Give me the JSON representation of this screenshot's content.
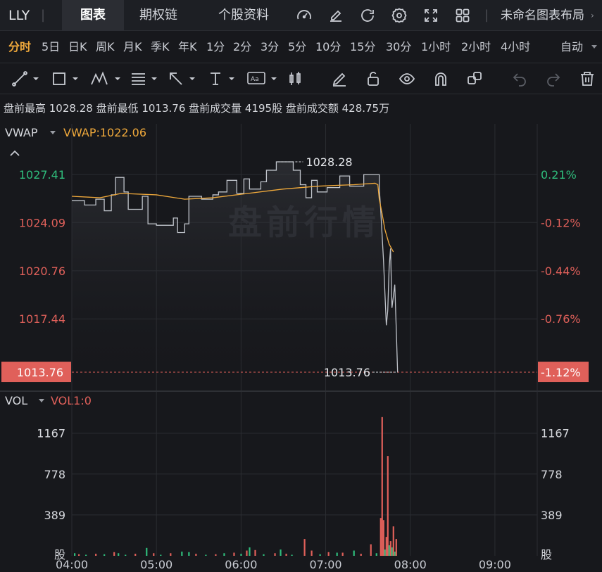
{
  "topbar": {
    "ticker": "LLY",
    "separator": "|",
    "tabs": [
      {
        "label": "图表",
        "active": true
      },
      {
        "label": "期权链",
        "active": false
      },
      {
        "label": "个股资料",
        "active": false
      }
    ],
    "icons": [
      "gauge-icon",
      "edit-icon",
      "refresh-icon",
      "settings-icon",
      "fullscreen-icon",
      "grid-layout-icon"
    ],
    "layout_name": "未命名图表布局",
    "layout_chevron": "›"
  },
  "periods": {
    "items": [
      "分时",
      "5日",
      "日K",
      "周K",
      "月K",
      "季K",
      "年K",
      "1分",
      "2分",
      "3分",
      "5分",
      "10分",
      "15分",
      "30分",
      "1小时",
      "2小时",
      "4小时"
    ],
    "active": "分时",
    "mode": "自动"
  },
  "toolbar": {
    "tools": [
      "line-tool-icon",
      "rectangle-tool-icon",
      "pattern-tool-icon",
      "fibonacci-tool-icon",
      "arrow-tool-icon",
      "text-tool-icon",
      "annotation-tool-icon",
      "candle-tool-icon",
      "pencil-icon",
      "unlock-icon",
      "eye-icon",
      "magnet-icon",
      "copy-icon",
      "undo-icon",
      "redo-icon",
      "trash-icon"
    ]
  },
  "info": {
    "text": "盘前最高 1028.28 盘前最低 1013.76 盘前成交量 4195股 盘前成交额 428.75万"
  },
  "chart_data": {
    "type": "line",
    "watermark": "盘前行情",
    "indicator": {
      "name": "VWAP",
      "label": "VWAP:1022.06"
    },
    "price_axis": {
      "ticks": [
        "1027.41",
        "1024.09",
        "1020.76",
        "1017.44"
      ],
      "current": "1013.76",
      "ylim": [
        1012.5,
        1030.9
      ]
    },
    "percent_axis": {
      "ticks": [
        "0.21%",
        "-0.12%",
        "-0.44%",
        "-0.76%"
      ],
      "current": "-1.12%"
    },
    "high_label": "1028.28",
    "low_label": "1013.76",
    "time_axis": {
      "labels": [
        "04:00",
        "05:00",
        "06:00",
        "07:00",
        "08:00",
        "09:00"
      ],
      "xlim_minutes": [
        0,
        330
      ]
    },
    "series": [
      {
        "name": "price",
        "color": "#bfc3ca",
        "points": [
          [
            0,
            1025.6
          ],
          [
            9,
            1025.6
          ],
          [
            9,
            1025.3
          ],
          [
            17,
            1025.3
          ],
          [
            17,
            1025.7
          ],
          [
            23,
            1025.7
          ],
          [
            23,
            1024.9
          ],
          [
            28,
            1024.9
          ],
          [
            28,
            1026.0
          ],
          [
            31,
            1026.0
          ],
          [
            31,
            1027.2
          ],
          [
            37,
            1027.2
          ],
          [
            37,
            1026.2
          ],
          [
            40,
            1026.2
          ],
          [
            40,
            1025.0
          ],
          [
            50,
            1025.0
          ],
          [
            50,
            1025.9
          ],
          [
            54,
            1025.9
          ],
          [
            54,
            1024.0
          ],
          [
            60,
            1024.0
          ],
          [
            60,
            1023.9
          ],
          [
            72,
            1023.9
          ],
          [
            72,
            1024.4
          ],
          [
            75,
            1024.4
          ],
          [
            75,
            1023.4
          ],
          [
            80,
            1023.4
          ],
          [
            80,
            1024.0
          ],
          [
            83,
            1024.0
          ],
          [
            83,
            1025.9
          ],
          [
            92,
            1025.9
          ],
          [
            92,
            1025.7
          ],
          [
            100,
            1025.7
          ],
          [
            100,
            1026.0
          ],
          [
            104,
            1026.0
          ],
          [
            104,
            1026.2
          ],
          [
            110,
            1026.2
          ],
          [
            110,
            1027.0
          ],
          [
            117,
            1027.0
          ],
          [
            117,
            1026.1
          ],
          [
            122,
            1026.1
          ],
          [
            122,
            1027.1
          ],
          [
            126,
            1027.1
          ],
          [
            126,
            1026.4
          ],
          [
            134,
            1026.4
          ],
          [
            134,
            1026.9
          ],
          [
            138,
            1026.9
          ],
          [
            138,
            1027.7
          ],
          [
            145,
            1027.7
          ],
          [
            145,
            1028.28
          ],
          [
            157,
            1028.28
          ],
          [
            157,
            1027.7
          ],
          [
            162,
            1027.7
          ],
          [
            162,
            1026.7
          ],
          [
            166,
            1026.7
          ],
          [
            166,
            1025.8
          ],
          [
            170,
            1025.8
          ],
          [
            170,
            1027.0
          ],
          [
            174,
            1027.0
          ],
          [
            174,
            1026.2
          ],
          [
            181,
            1026.2
          ],
          [
            181,
            1026.5
          ],
          [
            190,
            1026.5
          ],
          [
            190,
            1027.3
          ],
          [
            197,
            1027.3
          ],
          [
            197,
            1026.6
          ],
          [
            207,
            1026.6
          ],
          [
            207,
            1027.4
          ],
          [
            218,
            1027.4
          ],
          [
            218,
            1026.5
          ],
          [
            219,
            1025.0
          ],
          [
            221,
            1021.5
          ],
          [
            223,
            1017.0
          ],
          [
            224,
            1018.0
          ],
          [
            225,
            1021.0
          ],
          [
            226,
            1022.3
          ],
          [
            227,
            1018.2
          ],
          [
            228,
            1019.0
          ],
          [
            229,
            1019.8
          ],
          [
            230,
            1016.9
          ],
          [
            231,
            1013.76
          ]
        ]
      },
      {
        "name": "VWAP",
        "color": "#f0a93b",
        "points": [
          [
            0,
            1025.9
          ],
          [
            20,
            1025.8
          ],
          [
            35,
            1026.1
          ],
          [
            60,
            1026.0
          ],
          [
            80,
            1025.7
          ],
          [
            100,
            1025.8
          ],
          [
            125,
            1026.1
          ],
          [
            150,
            1026.4
          ],
          [
            175,
            1026.6
          ],
          [
            200,
            1026.7
          ],
          [
            215,
            1026.8
          ],
          [
            217,
            1026.7
          ],
          [
            218,
            1025.7
          ],
          [
            220,
            1024.7
          ],
          [
            222,
            1023.6
          ],
          [
            225,
            1022.6
          ],
          [
            228,
            1022.06
          ]
        ]
      }
    ],
    "volume": {
      "indicator_label": "VOL1:0",
      "ticks": [
        "1167",
        "778",
        "389"
      ],
      "unit": "股",
      "ymax": 1560,
      "bars": [
        [
          2,
          25,
          "up"
        ],
        [
          5,
          15,
          "down"
        ],
        [
          10,
          10,
          "up"
        ],
        [
          17,
          20,
          "down"
        ],
        [
          23,
          15,
          "up"
        ],
        [
          30,
          35,
          "down"
        ],
        [
          33,
          25,
          "up"
        ],
        [
          38,
          10,
          "up"
        ],
        [
          45,
          20,
          "down"
        ],
        [
          53,
          75,
          "up"
        ],
        [
          58,
          25,
          "down"
        ],
        [
          63,
          10,
          "up"
        ],
        [
          70,
          25,
          "down"
        ],
        [
          78,
          40,
          "up"
        ],
        [
          83,
          35,
          "up"
        ],
        [
          88,
          20,
          "down"
        ],
        [
          95,
          10,
          "up"
        ],
        [
          102,
          15,
          "down"
        ],
        [
          108,
          25,
          "up"
        ],
        [
          115,
          30,
          "down"
        ],
        [
          120,
          20,
          "up"
        ],
        [
          124,
          50,
          "down"
        ],
        [
          126,
          80,
          "up"
        ],
        [
          130,
          55,
          "down"
        ],
        [
          136,
          15,
          "up"
        ],
        [
          144,
          25,
          "down"
        ],
        [
          148,
          60,
          "up"
        ],
        [
          152,
          20,
          "down"
        ],
        [
          156,
          10,
          "up"
        ],
        [
          165,
          160,
          "down"
        ],
        [
          170,
          50,
          "down"
        ],
        [
          176,
          15,
          "up"
        ],
        [
          182,
          35,
          "down"
        ],
        [
          188,
          30,
          "up"
        ],
        [
          192,
          30,
          "down"
        ],
        [
          200,
          50,
          "up"
        ],
        [
          205,
          20,
          "down"
        ],
        [
          212,
          110,
          "down"
        ],
        [
          216,
          25,
          "up"
        ],
        [
          219,
          360,
          "down"
        ],
        [
          220,
          1320,
          "down"
        ],
        [
          221,
          340,
          "down"
        ],
        [
          222,
          60,
          "up"
        ],
        [
          223,
          180,
          "down"
        ],
        [
          224,
          950,
          "down"
        ],
        [
          225,
          100,
          "up"
        ],
        [
          226,
          140,
          "down"
        ],
        [
          227,
          80,
          "up"
        ],
        [
          228,
          280,
          "down"
        ],
        [
          229,
          40,
          "up"
        ],
        [
          230,
          160,
          "down"
        ]
      ]
    }
  }
}
